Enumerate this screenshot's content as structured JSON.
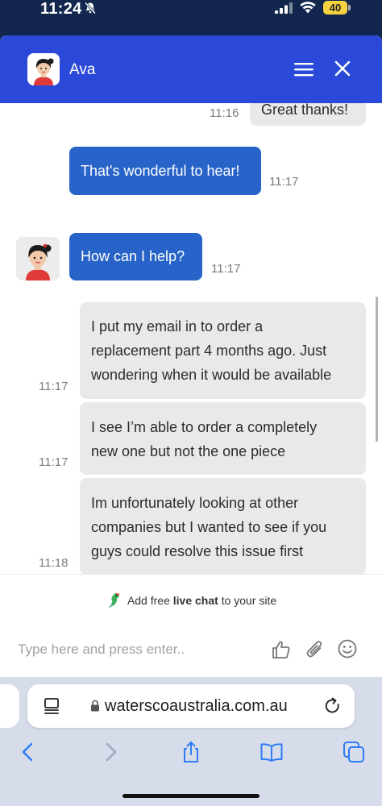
{
  "status_bar": {
    "time": "11:24",
    "battery_level": "40"
  },
  "chat": {
    "agent_name": "Ava",
    "messages": [
      {
        "sender": "user",
        "text": "Great thanks!",
        "time": "11:16"
      },
      {
        "sender": "agent",
        "text": "That's wonderful to hear!",
        "time": "11:17"
      },
      {
        "sender": "agent",
        "text": "How can I help?",
        "time": "11:17"
      },
      {
        "sender": "user",
        "lines": [
          "I put my email in to order a",
          "replacement part 4 months ago. Just",
          "wondering when it would be available"
        ],
        "time": "11:17"
      },
      {
        "sender": "user",
        "lines": [
          "I see I’m able to order a completely",
          "new one but not the one piece"
        ],
        "time": "11:17"
      },
      {
        "sender": "user",
        "lines": [
          "Im unfortunately looking at other",
          "companies but I wanted to see if you",
          "guys could resolve this issue first"
        ],
        "time": "11:18"
      }
    ],
    "promo": {
      "prefix": "Add free",
      "bold": "live chat",
      "suffix": "to your site"
    },
    "composer": {
      "placeholder": "Type here and press enter.."
    }
  },
  "browser": {
    "address": "waterscoaustralia.com.au"
  },
  "colors": {
    "header": "#2a49d8",
    "agent_bubble": "#2763c8",
    "user_bubble": "#e9e9e9",
    "status_bar": "#12264e",
    "toolbar": "#d6dcea",
    "ios_blue": "#2f7cf6"
  }
}
